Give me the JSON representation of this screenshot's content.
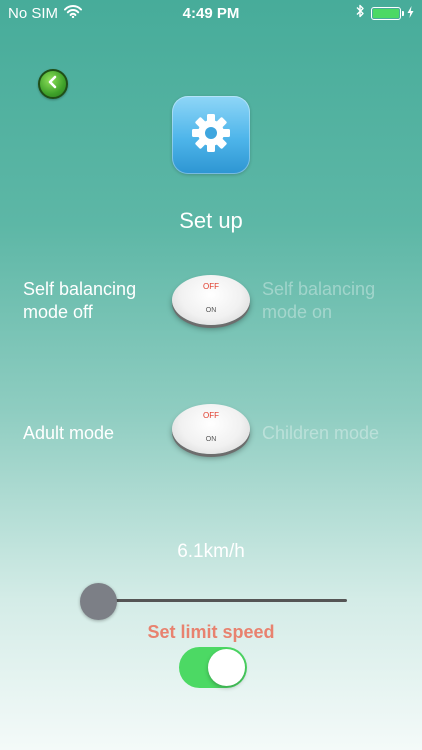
{
  "status": {
    "carrier": "No SIM",
    "time": "4:49 PM",
    "battery_percent": 100,
    "battery_color": "#4cd964"
  },
  "icons": {
    "back": "back-arrow-icon",
    "settings": "gear-icon",
    "wifi": "wifi-icon",
    "bluetooth": "bluetooth-icon",
    "charging": "charging-bolt-icon"
  },
  "title": "Set up",
  "balance": {
    "off_label_line1": "Self balancing",
    "off_label_line2": "mode off",
    "on_label_line1": "Self balancing",
    "on_label_line2": "mode on",
    "switch_off": "OFF",
    "switch_on": "ON"
  },
  "mode": {
    "left_label": "Adult mode",
    "right_label": "Children mode",
    "switch_off": "OFF",
    "switch_on": "ON"
  },
  "speed": {
    "value_text": "6.1km/h",
    "slider_fraction": 0.0,
    "limit_label": "Set limit speed",
    "limit_enabled": true,
    "toggle_color": "#4cd964",
    "limit_label_color": "#e8826f"
  }
}
